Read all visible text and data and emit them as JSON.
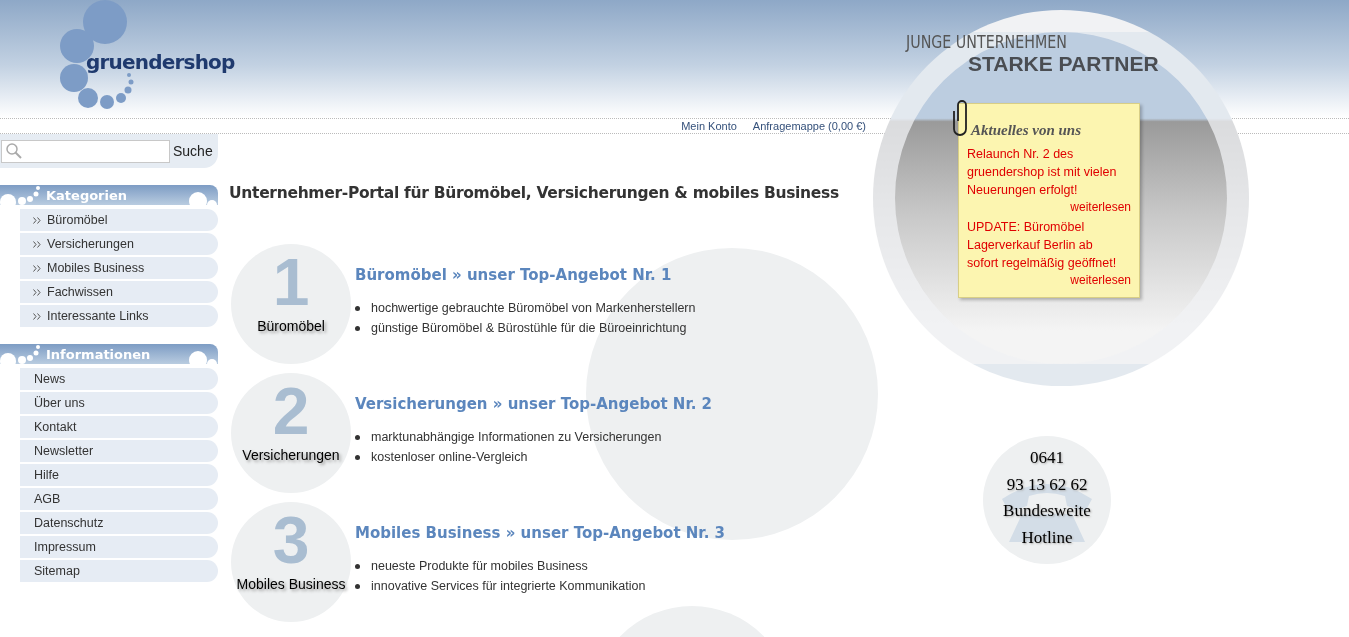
{
  "logo": {
    "text": "gruendershop"
  },
  "slogan": {
    "line1": "JUNGE UNTERNEHMEN",
    "line2": "STARKE PARTNER"
  },
  "top_links": [
    "Mein Konto",
    "Anfragemappe (0,00 €)"
  ],
  "search": {
    "button": "Suche"
  },
  "sidebar": [
    {
      "title": "Kategorien",
      "kind": "arrows",
      "items": [
        "Büromöbel",
        "Versicherungen",
        "Mobiles Business",
        "Fachwissen",
        "Interessante Links"
      ]
    },
    {
      "title": "Informationen",
      "kind": "plain",
      "items": [
        "News",
        "Über uns",
        "Kontakt",
        "Newsletter",
        "Hilfe",
        "AGB",
        "Datenschutz",
        "Impressum",
        "Sitemap"
      ]
    }
  ],
  "headline": "Unternehmer-Portal für Büromöbel, Versicherungen & mobiles Business",
  "offers": [
    {
      "number": "1",
      "label": "Büromöbel",
      "heading": "Büromöbel » unser Top-Angebot Nr. 1",
      "bullets": [
        "hochwertige gebrauchte Büromöbel von Markenherstellern",
        "günstige Büromöbel & Bürostühle für die Büroeinrichtung"
      ]
    },
    {
      "number": "2",
      "label": "Versicherungen",
      "heading": "Versicherungen » unser Top-Angebot Nr. 2",
      "bullets": [
        "marktunabhängige Informationen zu Versicherungen",
        "kostenloser online-Vergleich"
      ]
    },
    {
      "number": "3",
      "label": "Mobiles Business",
      "heading": "Mobiles Business » unser Top-Angebot Nr. 3",
      "bullets": [
        "neueste Produkte für mobiles Business",
        "innovative Services für integrierte Kommunikation"
      ]
    }
  ],
  "news": {
    "title": "Aktuelles von uns",
    "items": [
      {
        "text": "Relaunch Nr. 2 des gruendershop ist mit vielen Neuerungen erfolgt!",
        "link": "weiterlesen"
      },
      {
        "text": "UPDATE: Büromöbel Lagerverkauf Berlin ab sofort regelmäßig geöffnet!",
        "link": "weiterlesen"
      }
    ]
  },
  "hotline": {
    "lines": [
      "0641",
      "93 13 62 62",
      "Bundesweite",
      "Hotline"
    ]
  }
}
